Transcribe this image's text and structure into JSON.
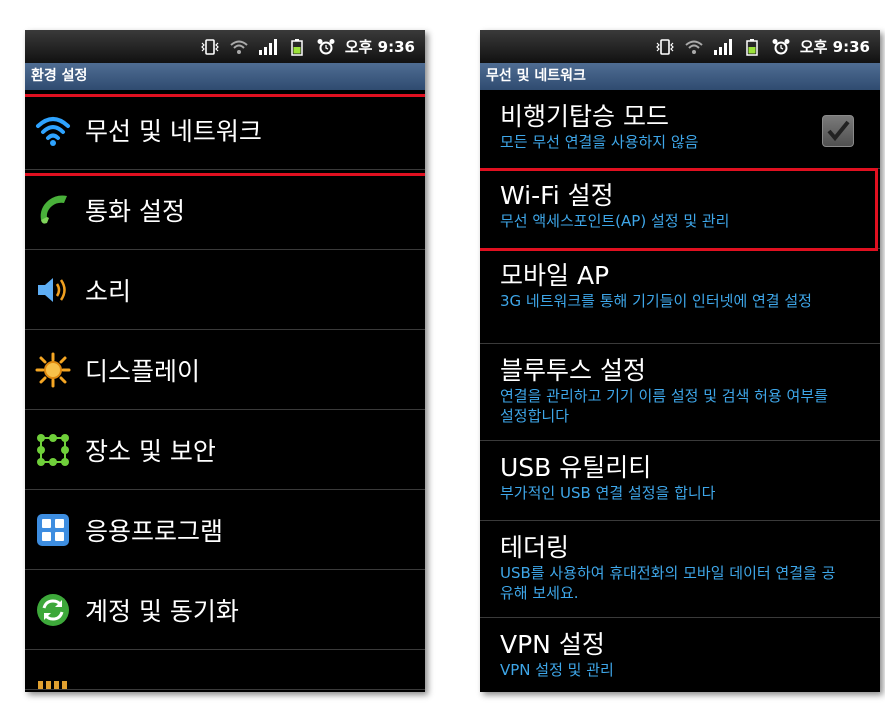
{
  "status_bar": {
    "time": "오후 9:36"
  },
  "left_screen": {
    "title": "환경 설정",
    "items": [
      {
        "label": "무선 및 네트워크",
        "icon": "wifi-icon"
      },
      {
        "label": "통화 설정",
        "icon": "phone-icon"
      },
      {
        "label": "소리",
        "icon": "speaker-icon"
      },
      {
        "label": "디스플레이",
        "icon": "brightness-icon"
      },
      {
        "label": "장소 및 보안",
        "icon": "security-grid-icon"
      },
      {
        "label": "응용프로그램",
        "icon": "apps-icon"
      },
      {
        "label": "계정 및 동기화",
        "icon": "sync-icon"
      }
    ],
    "highlighted_item": "무선 및 네트워크"
  },
  "right_screen": {
    "title": "무선 및 네트워크",
    "items": [
      {
        "title": "비행기탑승 모드",
        "summary": "모든 무선 연결을 사용하지 않음"
      },
      {
        "title": "Wi-Fi 설정",
        "summary": "무선 액세스포인트(AP) 설정 및 관리"
      },
      {
        "title": "모바일 AP",
        "summary": "3G 네트워크를 통해 기기들이 인터넷에 연결 설정"
      },
      {
        "title": "블루투스 설정",
        "summary": "연결을 관리하고 기기 이름 설정 및 검색 허용 여부를 설정합니다"
      },
      {
        "title": "USB 유틸리티",
        "summary": "부가적인 USB 연결 설정을 합니다"
      },
      {
        "title": "테더링",
        "summary": "USB를 사용하여 휴대전화의 모바일 데이터 연결을 공유해 보세요."
      },
      {
        "title": "VPN 설정",
        "summary": "VPN 설정 및 관리"
      }
    ],
    "highlighted_item": "Wi-Fi 설정"
  },
  "colors": {
    "highlight": "#e01020",
    "summary_text": "#3ea6e8",
    "title_bar": "#3f5c82"
  }
}
